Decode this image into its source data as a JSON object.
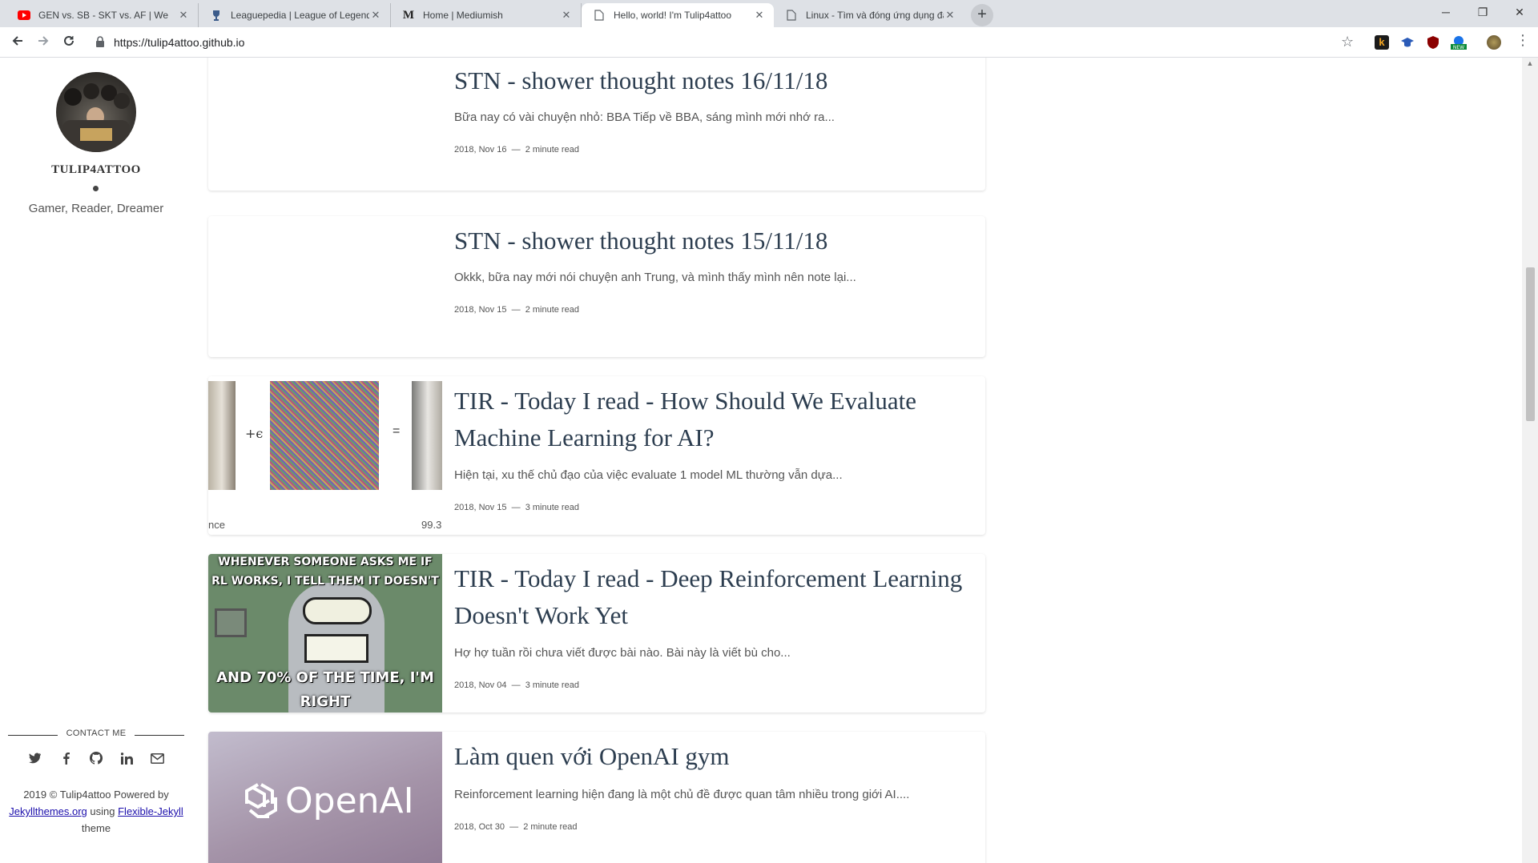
{
  "browser": {
    "tabs": [
      {
        "title": "GEN vs. SB - SKT vs. AF | We",
        "favicon": "youtube-icon"
      },
      {
        "title": "Leaguepedia | League of Legends",
        "favicon": "trophy-icon"
      },
      {
        "title": "Home | Mediumish",
        "favicon": "medium-icon"
      },
      {
        "title": "Hello, world! I'm Tulip4attoo",
        "favicon": "page-icon"
      },
      {
        "title": "Linux - Tìm và đóng ứng dụng đa",
        "favicon": "page-icon"
      }
    ],
    "active_tab_index": 3,
    "url": "https://tulip4attoo.github.io"
  },
  "sidebar": {
    "site_name": "TULIP4ATTOO",
    "tagline": "Gamer, Reader, Dreamer",
    "contact_label": "CONTACT ME",
    "social_icons": [
      "twitter-icon",
      "facebook-icon",
      "github-icon",
      "linkedin-icon",
      "email-icon"
    ],
    "footer": {
      "prefix": "2019 © Tulip4attoo Powered by ",
      "link1": "Jekyllthemes.org",
      "middle": " using ",
      "link2": "Flexible-Jekyll",
      "suffix": " theme"
    }
  },
  "posts": [
    {
      "title": "STN - shower thought notes 16/11/18",
      "excerpt": "Bữa nay có vài chuyện nhỏ: BBA Tiếp về BBA, sáng mình mới nhớ ra...",
      "date": "2018, Nov 16",
      "sep": "—",
      "read": "2 minute read",
      "thumb": "none"
    },
    {
      "title": "STN - shower thought notes 15/11/18",
      "excerpt": "Okkk, bữa nay mới nói chuyện anh Trung, và mình thấy mình nên note lại...",
      "date": "2018, Nov 15",
      "sep": "—",
      "read": "2 minute read",
      "thumb": "none"
    },
    {
      "title": "TIR - Today I read - How Should We Evaluate Machine Learning for AI?",
      "excerpt": "Hiện tại, xu thế chủ đạo của việc evaluate 1 model ML thường vẫn dựa...",
      "date": "2018, Nov 15",
      "sep": "—",
      "read": "3 minute read",
      "thumb": "adversarial",
      "thumb_text": {
        "plus": "+ϵ",
        "eq": "=",
        "left": "nce",
        "right": "99.3"
      }
    },
    {
      "title": "TIR - Today I read - Deep Reinforcement Learning Doesn't Work Yet",
      "excerpt": "Hợ hợ tuần rồi chưa viết được bài nào. Bài này là viết bù cho...",
      "date": "2018, Nov 04",
      "sep": "—",
      "read": "3 minute read",
      "thumb": "bender",
      "thumb_text": {
        "top1": "WHENEVER SOMEONE ASKS ME IF",
        "top2": "RL WORKS, I TELL THEM IT DOESN'T",
        "bottom1": "AND 70% OF THE TIME, I'M",
        "bottom2": "RIGHT"
      }
    },
    {
      "title": "Làm quen với OpenAI gym",
      "excerpt": "Reinforcement learning hiện đang là một chủ đề được quan tâm nhiều trong giới AI....",
      "date": "2018, Oct 30",
      "sep": "—",
      "read": "2 minute read",
      "thumb": "openai",
      "thumb_text": {
        "logo": "OpenAI"
      }
    }
  ]
}
